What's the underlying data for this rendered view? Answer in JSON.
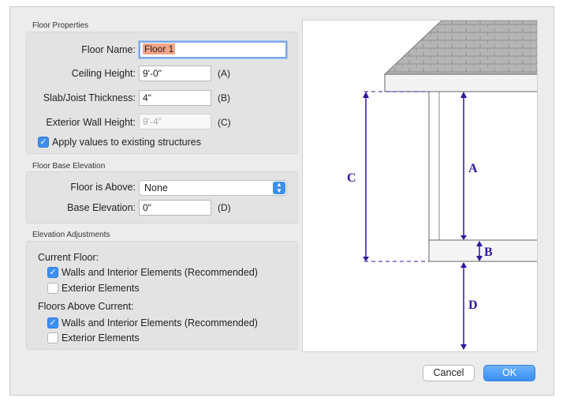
{
  "floor_properties": {
    "title": "Floor Properties",
    "floor_name_label": "Floor Name:",
    "floor_name_value": "Floor 1",
    "ceiling_height_label": "Ceiling Height:",
    "ceiling_height_value": "9'-0\"",
    "ceiling_height_letter": "(A)",
    "slab_label": "Slab/Joist Thickness:",
    "slab_value": "4\"",
    "slab_letter": "(B)",
    "ext_wall_label": "Exterior Wall Height:",
    "ext_wall_value": "9'-4\"",
    "ext_wall_letter": "(C)",
    "apply_label": "Apply values to existing structures",
    "apply_checked": true
  },
  "floor_base_elevation": {
    "title": "Floor Base Elevation",
    "floor_above_label": "Floor is Above:",
    "floor_above_value": "None",
    "base_elev_label": "Base Elevation:",
    "base_elev_value": "0\"",
    "base_elev_letter": "(D)"
  },
  "elevation_adjustments": {
    "title": "Elevation Adjustments",
    "current_floor_label": "Current Floor:",
    "current_walls_label": "Walls and Interior Elements (Recommended)",
    "current_walls_checked": true,
    "current_exterior_label": "Exterior Elements",
    "current_exterior_checked": false,
    "above_label": "Floors Above Current:",
    "above_walls_label": "Walls and Interior Elements (Recommended)",
    "above_walls_checked": true,
    "above_exterior_label": "Exterior Elements",
    "above_exterior_checked": false
  },
  "diagram": {
    "label_a": "A",
    "label_b": "B",
    "label_c": "C",
    "label_d": "D",
    "dimension_color": "#2a1a9e"
  },
  "buttons": {
    "cancel": "Cancel",
    "ok": "OK"
  },
  "icons": {
    "check": "checkmark-icon",
    "select_arrows": "up-down-chevron-icon"
  }
}
